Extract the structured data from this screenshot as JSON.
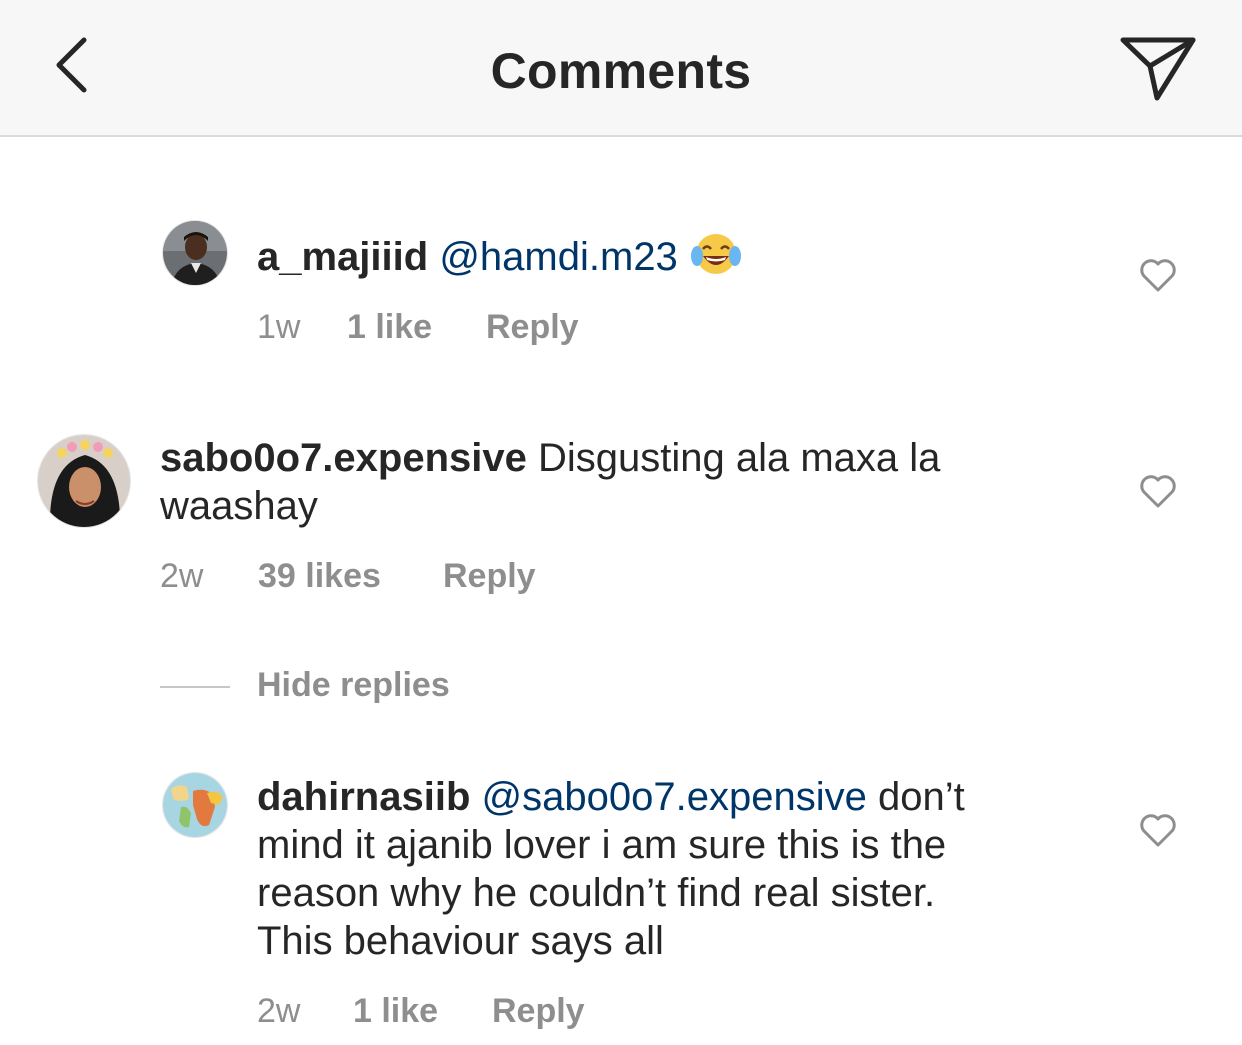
{
  "header": {
    "title": "Comments",
    "back_icon": "chevron-left-icon",
    "share_icon": "paper-plane-icon"
  },
  "comments": [
    {
      "username": "a_majiiid",
      "mention": "@hamdi.m23",
      "emoji": "face-with-tears-of-joy",
      "text": "",
      "time": "1w",
      "likes": "1 like",
      "reply": "Reply"
    },
    {
      "username": "sabo0o7.expensive",
      "mention": "",
      "text_line1": "Disgusting ala maxa la",
      "text_line2": "waashay",
      "time": "2w",
      "likes": "39 likes",
      "reply": "Reply"
    }
  ],
  "hide_replies": "Hide replies",
  "reply_comment": {
    "username": "dahirnasiib",
    "mention": "@sabo0o7.expensive",
    "text_line1_tail": "don’t",
    "text_line2": "mind it ajanib lover i am sure this is the",
    "text_line3": "reason why he couldn’t find real sister.",
    "text_line4": "This behaviour says all",
    "time": "2w",
    "likes": "1 like",
    "reply": "Reply"
  },
  "colors": {
    "header_bg": "#f7f7f7",
    "text": "#262626",
    "mention": "#003569",
    "meta": "#8e8e8e"
  }
}
